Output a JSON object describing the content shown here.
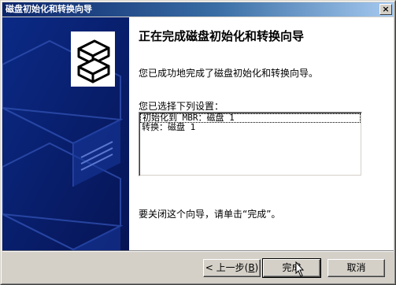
{
  "window": {
    "title": "磁盘初始化和转换向导",
    "close_glyph": "×"
  },
  "wizard": {
    "heading": "正在完成磁盘初始化和转换向导",
    "intro": "您已成功地完成了磁盘初始化和转换向导。",
    "settings_label": "您已选择下列设置：",
    "settings": [
      "初始化到 MBR：磁盘 1",
      "转换：磁盘 1"
    ],
    "close_hint": "要关闭这个向导，请单击“完成”。"
  },
  "buttons": {
    "back_label": "< 上一步(",
    "back_mnemonic": "B",
    "back_suffix": ")",
    "finish_label": "完成",
    "cancel_label": "取消"
  },
  "icons": {
    "banner_art": "disk-drives-art-icon",
    "disk_stack": "disk-stack-icon",
    "pointer": "mouse-pointer-icon"
  },
  "colors": {
    "titlebar_start": "#0a246a",
    "titlebar_end": "#a6caf0",
    "banner_background": "#0a1d6b",
    "dialog_face": "#d4d0c8"
  }
}
